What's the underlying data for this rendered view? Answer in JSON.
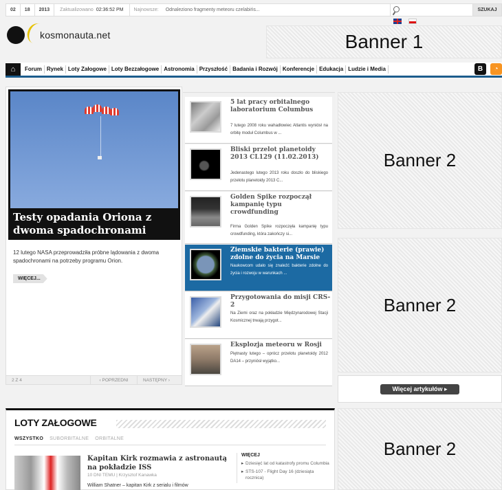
{
  "topbar": {
    "date": [
      "02",
      "18",
      "2013"
    ],
    "updated_label": "Zaktualizowano",
    "updated_time": "02:36:52 PM",
    "newest_label": "Najnowsze:",
    "newest_headline": "Odnaleziono fragmenty meteoru czelabińs...",
    "search_placeholder": "",
    "search_button": "SZUKAJ"
  },
  "logo": {
    "text": "kosmonauta.net"
  },
  "banners": {
    "b1": "Banner 1",
    "b2": "Banner 2"
  },
  "nav": {
    "items": [
      "Forum",
      "Rynek",
      "Loty Załogowe",
      "Loty Bezzałogowe",
      "Astronomia",
      "Przyszłość",
      "Badania i Rozwój",
      "Konferencje",
      "Edukacja",
      "Ludzie i Media"
    ],
    "icon_b": "B"
  },
  "feature": {
    "title": "Testy opadania Oriona z dwoma spadochronami",
    "lead": "12 lutego NASA przeprowadziła próbne lądowania z dwoma spadochronami na potrzeby programu Orion.",
    "more": "WIĘCEJ...",
    "pager": {
      "count": "2 Z 4",
      "prev": "‹ POPRZEDNI",
      "next": "NASTĘPNY ›"
    }
  },
  "list": [
    {
      "title": "5 lat pracy orbitalnego laboratorium Columbus",
      "summary": "7 lutego 2008 roku wahadłowiec Atlantis wyniósł na orbitę moduł Columbus w ..."
    },
    {
      "title": "Bliski przelot planetoidy 2013 CL129 (11.02.2013)",
      "summary": "Jedenastego lutego 2013 roku doszło do bliskiego przelotu planetoidy 2013 C..."
    },
    {
      "title": "Golden Spike rozpoczął kampanię typu crowdfunding",
      "summary": "Firma Golden Spike rozpoczęła kampanię typu crowdfunding, która zakończy si..."
    },
    {
      "title": "Ziemskie bakterie (prawie) zdolne do życia na Marsie",
      "summary": "Naukowcom udało się znaleźć bakterie zdolne do życia i rozwoju w warunkach ..."
    },
    {
      "title": "Przygotowania do misji CRS-2",
      "summary": "Na Ziemi oraz na pokładzie Międzynarodowej Stacji Kosmicznej trwają przygot..."
    },
    {
      "title": "Eksplozja meteoru w Rosji",
      "summary": "Piętnasty lutego – oprócz przelotu planetoidy 2012 DA14 – przyniósł wyjątko..."
    }
  ],
  "more_articles": "Więcej artykułów ▸",
  "section": {
    "title": "LOTY ZAŁOGOWE",
    "tabs": [
      "WSZYSTKO",
      "SUBORBITALNE",
      "ORBITALNE"
    ],
    "article": {
      "title": "Kapitan Kirk rozmawia z astronautą na pokładzie ISS",
      "meta": "10 DNI TEMU | Krzysztof Kanawka",
      "excerpt": "William Shatner – kapitan Kirk z serialu i filmów"
    },
    "side_heading": "WIĘCEJ",
    "side_items": [
      "Dziesięć lat od katastrofy promu Columbia",
      "STS-107 - Flight Day 16 (dziesiąta rocznica)"
    ]
  }
}
